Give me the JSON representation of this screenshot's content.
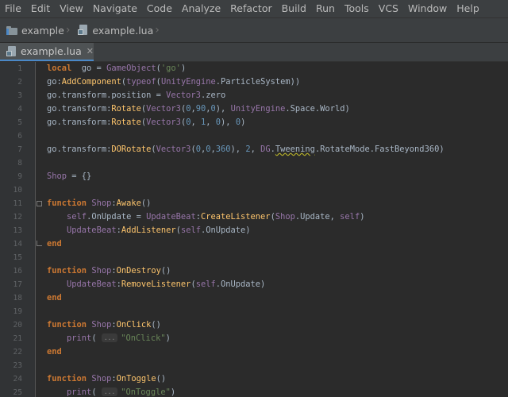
{
  "menu": [
    {
      "label": "File"
    },
    {
      "label": "Edit"
    },
    {
      "label": "View"
    },
    {
      "label": "Navigate"
    },
    {
      "label": "Code"
    },
    {
      "label": "Analyze"
    },
    {
      "label": "Refactor"
    },
    {
      "label": "Build"
    },
    {
      "label": "Run"
    },
    {
      "label": "Tools"
    },
    {
      "label": "VCS"
    },
    {
      "label": "Window"
    },
    {
      "label": "Help"
    }
  ],
  "breadcrumb": {
    "project": "example",
    "file": "example.lua",
    "project_icon": "folder-icon",
    "file_icon": "lua-file-icon"
  },
  "tabs": [
    {
      "label": "example.lua",
      "icon": "lua-file-icon",
      "active": true
    }
  ],
  "colors": {
    "background": "#2b2b2b",
    "gutter": "#313335",
    "keyword": "#cc7832",
    "function": "#ffc66d",
    "string": "#6a8759",
    "number": "#6897bb",
    "class": "#9876aa",
    "identifier": "#a9b7c6"
  },
  "editor": {
    "lines": [
      {
        "n": "1",
        "fold": "",
        "tokens": [
          [
            "kw",
            "local"
          ],
          [
            "",
            "  go = "
          ],
          [
            "cls",
            "GameObject"
          ],
          [
            "",
            "("
          ],
          [
            "str",
            "'go'"
          ],
          [
            "",
            ")"
          ]
        ]
      },
      {
        "n": "2",
        "fold": "",
        "tokens": [
          [
            "",
            "go:"
          ],
          [
            "fn",
            "AddComponent"
          ],
          [
            "",
            "("
          ],
          [
            "cls",
            "typeof"
          ],
          [
            "",
            "("
          ],
          [
            "cls",
            "UnityEngine"
          ],
          [
            "",
            "."
          ],
          [
            "",
            "ParticleSystem"
          ],
          [
            "",
            "))"
          ]
        ]
      },
      {
        "n": "3",
        "fold": "",
        "tokens": [
          [
            "",
            "go.transform.position = "
          ],
          [
            "cls",
            "Vector3"
          ],
          [
            "",
            ".zero"
          ]
        ]
      },
      {
        "n": "4",
        "fold": "",
        "tokens": [
          [
            "",
            "go.transform:"
          ],
          [
            "fn",
            "Rotate"
          ],
          [
            "",
            "("
          ],
          [
            "cls",
            "Vector3"
          ],
          [
            "",
            "("
          ],
          [
            "num",
            "0"
          ],
          [
            "",
            ","
          ],
          [
            "num",
            "90"
          ],
          [
            "",
            ","
          ],
          [
            "num",
            "0"
          ],
          [
            "",
            ")"
          ],
          [
            "",
            ", "
          ],
          [
            "cls",
            "UnityEngine"
          ],
          [
            "",
            ".Space.World)"
          ]
        ]
      },
      {
        "n": "5",
        "fold": "",
        "tokens": [
          [
            "",
            "go.transform:"
          ],
          [
            "fn",
            "Rotate"
          ],
          [
            "",
            "("
          ],
          [
            "cls",
            "Vector3"
          ],
          [
            "",
            "("
          ],
          [
            "num",
            "0"
          ],
          [
            "",
            ", "
          ],
          [
            "num",
            "1"
          ],
          [
            "",
            ", "
          ],
          [
            "num",
            "0"
          ],
          [
            "",
            "), "
          ],
          [
            "num",
            "0"
          ],
          [
            "",
            ")"
          ]
        ]
      },
      {
        "n": "6",
        "fold": "",
        "tokens": []
      },
      {
        "n": "7",
        "fold": "",
        "tokens": [
          [
            "",
            "go.transform:"
          ],
          [
            "fn",
            "DORotate"
          ],
          [
            "",
            "("
          ],
          [
            "cls",
            "Vector3"
          ],
          [
            "",
            "("
          ],
          [
            "num",
            "0"
          ],
          [
            "",
            ","
          ],
          [
            "num",
            "0"
          ],
          [
            "",
            ","
          ],
          [
            "num",
            "360"
          ],
          [
            "",
            "), "
          ],
          [
            "num",
            "2"
          ],
          [
            "",
            ", "
          ],
          [
            "cls",
            "DG"
          ],
          [
            "",
            "."
          ],
          [
            "warn",
            "Tweening"
          ],
          [
            "",
            ".RotateMode.FastBeyond360)"
          ]
        ]
      },
      {
        "n": "8",
        "fold": "",
        "tokens": []
      },
      {
        "n": "9",
        "fold": "",
        "tokens": [
          [
            "cls",
            "Shop"
          ],
          [
            "",
            " = {}"
          ]
        ]
      },
      {
        "n": "10",
        "fold": "",
        "tokens": []
      },
      {
        "n": "11",
        "fold": "start",
        "tokens": [
          [
            "kw",
            "function"
          ],
          [
            "",
            " "
          ],
          [
            "cls",
            "Shop"
          ],
          [
            "",
            ":"
          ],
          [
            "fn",
            "Awake"
          ],
          [
            "",
            "()"
          ]
        ]
      },
      {
        "n": "12",
        "fold": "",
        "tokens": [
          [
            "",
            "    "
          ],
          [
            "cls",
            "self"
          ],
          [
            "",
            ".OnUpdate = "
          ],
          [
            "cls",
            "UpdateBeat"
          ],
          [
            "",
            ":"
          ],
          [
            "fn",
            "CreateListener"
          ],
          [
            "",
            "("
          ],
          [
            "cls",
            "Shop"
          ],
          [
            "",
            ".Update, "
          ],
          [
            "cls",
            "self"
          ],
          [
            "",
            ")"
          ]
        ]
      },
      {
        "n": "13",
        "fold": "",
        "tokens": [
          [
            "",
            "    "
          ],
          [
            "cls",
            "UpdateBeat"
          ],
          [
            "",
            ":"
          ],
          [
            "fn",
            "AddListener"
          ],
          [
            "",
            "("
          ],
          [
            "cls",
            "self"
          ],
          [
            "",
            ".OnUpdate)"
          ]
        ]
      },
      {
        "n": "14",
        "fold": "end",
        "tokens": [
          [
            "kw",
            "end"
          ]
        ]
      },
      {
        "n": "15",
        "fold": "",
        "tokens": []
      },
      {
        "n": "16",
        "fold": "",
        "tokens": [
          [
            "kw",
            "function"
          ],
          [
            "",
            " "
          ],
          [
            "cls",
            "Shop"
          ],
          [
            "",
            ":"
          ],
          [
            "fn",
            "OnDestroy"
          ],
          [
            "",
            "()"
          ]
        ]
      },
      {
        "n": "17",
        "fold": "",
        "tokens": [
          [
            "",
            "    "
          ],
          [
            "cls",
            "UpdateBeat"
          ],
          [
            "",
            ":"
          ],
          [
            "fn",
            "RemoveListener"
          ],
          [
            "",
            "("
          ],
          [
            "cls",
            "self"
          ],
          [
            "",
            ".OnUpdate)"
          ]
        ]
      },
      {
        "n": "18",
        "fold": "",
        "tokens": [
          [
            "kw",
            "end"
          ]
        ]
      },
      {
        "n": "19",
        "fold": "",
        "tokens": []
      },
      {
        "n": "20",
        "fold": "",
        "tokens": [
          [
            "kw",
            "function"
          ],
          [
            "",
            " "
          ],
          [
            "cls",
            "Shop"
          ],
          [
            "",
            ":"
          ],
          [
            "fn",
            "OnClick"
          ],
          [
            "",
            "()"
          ]
        ]
      },
      {
        "n": "21",
        "fold": "",
        "tokens": [
          [
            "",
            "    "
          ],
          [
            "cls",
            "print"
          ],
          [
            "",
            "( "
          ],
          [
            "ph",
            "..."
          ],
          [
            "str",
            "\"OnClick\""
          ],
          [
            "",
            ")"
          ]
        ]
      },
      {
        "n": "22",
        "fold": "",
        "tokens": [
          [
            "kw",
            "end"
          ]
        ]
      },
      {
        "n": "23",
        "fold": "",
        "tokens": []
      },
      {
        "n": "24",
        "fold": "",
        "tokens": [
          [
            "kw",
            "function"
          ],
          [
            "",
            " "
          ],
          [
            "cls",
            "Shop"
          ],
          [
            "",
            ":"
          ],
          [
            "fn",
            "OnToggle"
          ],
          [
            "",
            "()"
          ]
        ]
      },
      {
        "n": "25",
        "fold": "",
        "tokens": [
          [
            "",
            "    "
          ],
          [
            "cls",
            "print"
          ],
          [
            "",
            "( "
          ],
          [
            "ph",
            "..."
          ],
          [
            "str",
            "\"OnToggle\""
          ],
          [
            "",
            ")"
          ]
        ]
      }
    ]
  }
}
